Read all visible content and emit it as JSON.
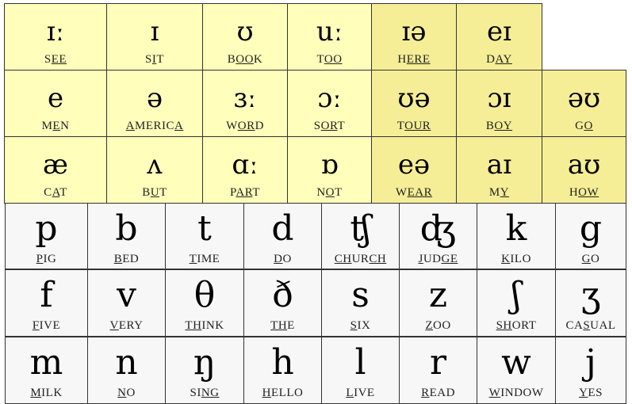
{
  "colors": {
    "monophthong": "#FFFFBB",
    "diphthong": "#F5EE96",
    "consonant": "#F7F7F7",
    "border": "#333333"
  },
  "vowels": [
    {
      "symbol": "ɪː",
      "type": "monophthong",
      "word": [
        {
          "t": "S"
        },
        {
          "t": "EE",
          "u": true
        }
      ]
    },
    {
      "symbol": "ɪ",
      "type": "monophthong",
      "word": [
        {
          "t": "S"
        },
        {
          "t": "I",
          "u": true
        },
        {
          "t": "T"
        }
      ]
    },
    {
      "symbol": "ʊ",
      "type": "monophthong",
      "word": [
        {
          "t": "B"
        },
        {
          "t": "OO",
          "u": true
        },
        {
          "t": "K"
        }
      ]
    },
    {
      "symbol": "uː",
      "type": "monophthong",
      "word": [
        {
          "t": "T"
        },
        {
          "t": "OO",
          "u": true
        }
      ]
    },
    {
      "symbol": "ɪə",
      "type": "diphthong",
      "word": [
        {
          "t": "H"
        },
        {
          "t": "ERE",
          "u": true
        }
      ]
    },
    {
      "symbol": "eɪ",
      "type": "diphthong",
      "word": [
        {
          "t": "D"
        },
        {
          "t": "AY",
          "u": true
        }
      ]
    },
    {
      "symbol": "e",
      "type": "monophthong",
      "word": [
        {
          "t": "M"
        },
        {
          "t": "E",
          "u": true
        },
        {
          "t": "N"
        }
      ]
    },
    {
      "symbol": "ə",
      "type": "monophthong",
      "word": [
        {
          "t": "A",
          "u": true
        },
        {
          "t": "MERIC"
        },
        {
          "t": "A",
          "u": true
        }
      ]
    },
    {
      "symbol": "ɜː",
      "type": "monophthong",
      "word": [
        {
          "t": "W"
        },
        {
          "t": "OR",
          "u": true
        },
        {
          "t": "D"
        }
      ]
    },
    {
      "symbol": "ɔː",
      "type": "monophthong",
      "word": [
        {
          "t": "S"
        },
        {
          "t": "OR",
          "u": true
        },
        {
          "t": "T"
        }
      ]
    },
    {
      "symbol": "ʊə",
      "type": "diphthong",
      "word": [
        {
          "t": "T"
        },
        {
          "t": "OUR",
          "u": true
        }
      ]
    },
    {
      "symbol": "ɔɪ",
      "type": "diphthong",
      "word": [
        {
          "t": "B"
        },
        {
          "t": "OY",
          "u": true
        }
      ]
    },
    {
      "symbol": "əʊ",
      "type": "diphthong",
      "word": [
        {
          "t": "G"
        },
        {
          "t": "O",
          "u": true
        }
      ]
    },
    {
      "symbol": "æ",
      "type": "monophthong",
      "word": [
        {
          "t": "C"
        },
        {
          "t": "A",
          "u": true
        },
        {
          "t": "T"
        }
      ]
    },
    {
      "symbol": "ʌ",
      "type": "monophthong",
      "word": [
        {
          "t": "B"
        },
        {
          "t": "U",
          "u": true
        },
        {
          "t": "T"
        }
      ]
    },
    {
      "symbol": "ɑː",
      "type": "monophthong",
      "word": [
        {
          "t": "P"
        },
        {
          "t": "AR",
          "u": true
        },
        {
          "t": "T"
        }
      ]
    },
    {
      "symbol": "ɒ",
      "type": "monophthong",
      "word": [
        {
          "t": "N"
        },
        {
          "t": "O",
          "u": true
        },
        {
          "t": "T"
        }
      ]
    },
    {
      "symbol": "eə",
      "type": "diphthong",
      "word": [
        {
          "t": "W"
        },
        {
          "t": "EAR",
          "u": true
        }
      ]
    },
    {
      "symbol": "aɪ",
      "type": "diphthong",
      "word": [
        {
          "t": "M"
        },
        {
          "t": "Y",
          "u": true
        }
      ]
    },
    {
      "symbol": "aʊ",
      "type": "diphthong",
      "word": [
        {
          "t": "H"
        },
        {
          "t": "OW",
          "u": true
        }
      ]
    }
  ],
  "consonants": [
    {
      "symbol": "p",
      "word": [
        {
          "t": "P",
          "u": true
        },
        {
          "t": "IG"
        }
      ]
    },
    {
      "symbol": "b",
      "word": [
        {
          "t": "B",
          "u": true
        },
        {
          "t": "ED"
        }
      ]
    },
    {
      "symbol": "t",
      "word": [
        {
          "t": "T",
          "u": true
        },
        {
          "t": "IME"
        }
      ]
    },
    {
      "symbol": "d",
      "word": [
        {
          "t": "D",
          "u": true
        },
        {
          "t": "O"
        }
      ]
    },
    {
      "symbol": "ʧ",
      "word": [
        {
          "t": "CH",
          "u": true
        },
        {
          "t": "UR"
        },
        {
          "t": "CH",
          "u": true
        }
      ]
    },
    {
      "symbol": "ʤ",
      "word": [
        {
          "t": "J",
          "u": true
        },
        {
          "t": "UD"
        },
        {
          "t": "GE",
          "u": true
        }
      ]
    },
    {
      "symbol": "k",
      "word": [
        {
          "t": "K",
          "u": true
        },
        {
          "t": "ILO"
        }
      ]
    },
    {
      "symbol": "g",
      "word": [
        {
          "t": "G",
          "u": true
        },
        {
          "t": "O"
        }
      ]
    },
    {
      "symbol": "f",
      "word": [
        {
          "t": "F",
          "u": true
        },
        {
          "t": "IVE"
        }
      ]
    },
    {
      "symbol": "v",
      "word": [
        {
          "t": "V",
          "u": true
        },
        {
          "t": "ERY"
        }
      ]
    },
    {
      "symbol": "θ",
      "word": [
        {
          "t": "TH",
          "u": true
        },
        {
          "t": "INK"
        }
      ]
    },
    {
      "symbol": "ð",
      "word": [
        {
          "t": "TH",
          "u": true
        },
        {
          "t": "E"
        }
      ]
    },
    {
      "symbol": "s",
      "word": [
        {
          "t": "S",
          "u": true
        },
        {
          "t": "IX"
        }
      ]
    },
    {
      "symbol": "z",
      "word": [
        {
          "t": "Z",
          "u": true
        },
        {
          "t": "OO"
        }
      ]
    },
    {
      "symbol": "ʃ",
      "word": [
        {
          "t": "SH",
          "u": true
        },
        {
          "t": "ORT"
        }
      ]
    },
    {
      "symbol": "ʒ",
      "word": [
        {
          "t": "CA"
        },
        {
          "t": "S",
          "u": true
        },
        {
          "t": "UAL"
        }
      ]
    },
    {
      "symbol": "m",
      "word": [
        {
          "t": "M",
          "u": true
        },
        {
          "t": "ILK"
        }
      ]
    },
    {
      "symbol": "n",
      "word": [
        {
          "t": "N",
          "u": true
        },
        {
          "t": "O"
        }
      ]
    },
    {
      "symbol": "ŋ",
      "word": [
        {
          "t": "SI"
        },
        {
          "t": "NG",
          "u": true
        }
      ]
    },
    {
      "symbol": "h",
      "word": [
        {
          "t": "H",
          "u": true
        },
        {
          "t": "ELLO"
        }
      ]
    },
    {
      "symbol": "l",
      "word": [
        {
          "t": "L",
          "u": true
        },
        {
          "t": "IVE"
        }
      ]
    },
    {
      "symbol": "r",
      "word": [
        {
          "t": "R",
          "u": true
        },
        {
          "t": "EAD"
        }
      ]
    },
    {
      "symbol": "w",
      "word": [
        {
          "t": "W",
          "u": true
        },
        {
          "t": "INDOW"
        }
      ]
    },
    {
      "symbol": "j",
      "word": [
        {
          "t": "Y",
          "u": true
        },
        {
          "t": "ES"
        }
      ]
    }
  ]
}
